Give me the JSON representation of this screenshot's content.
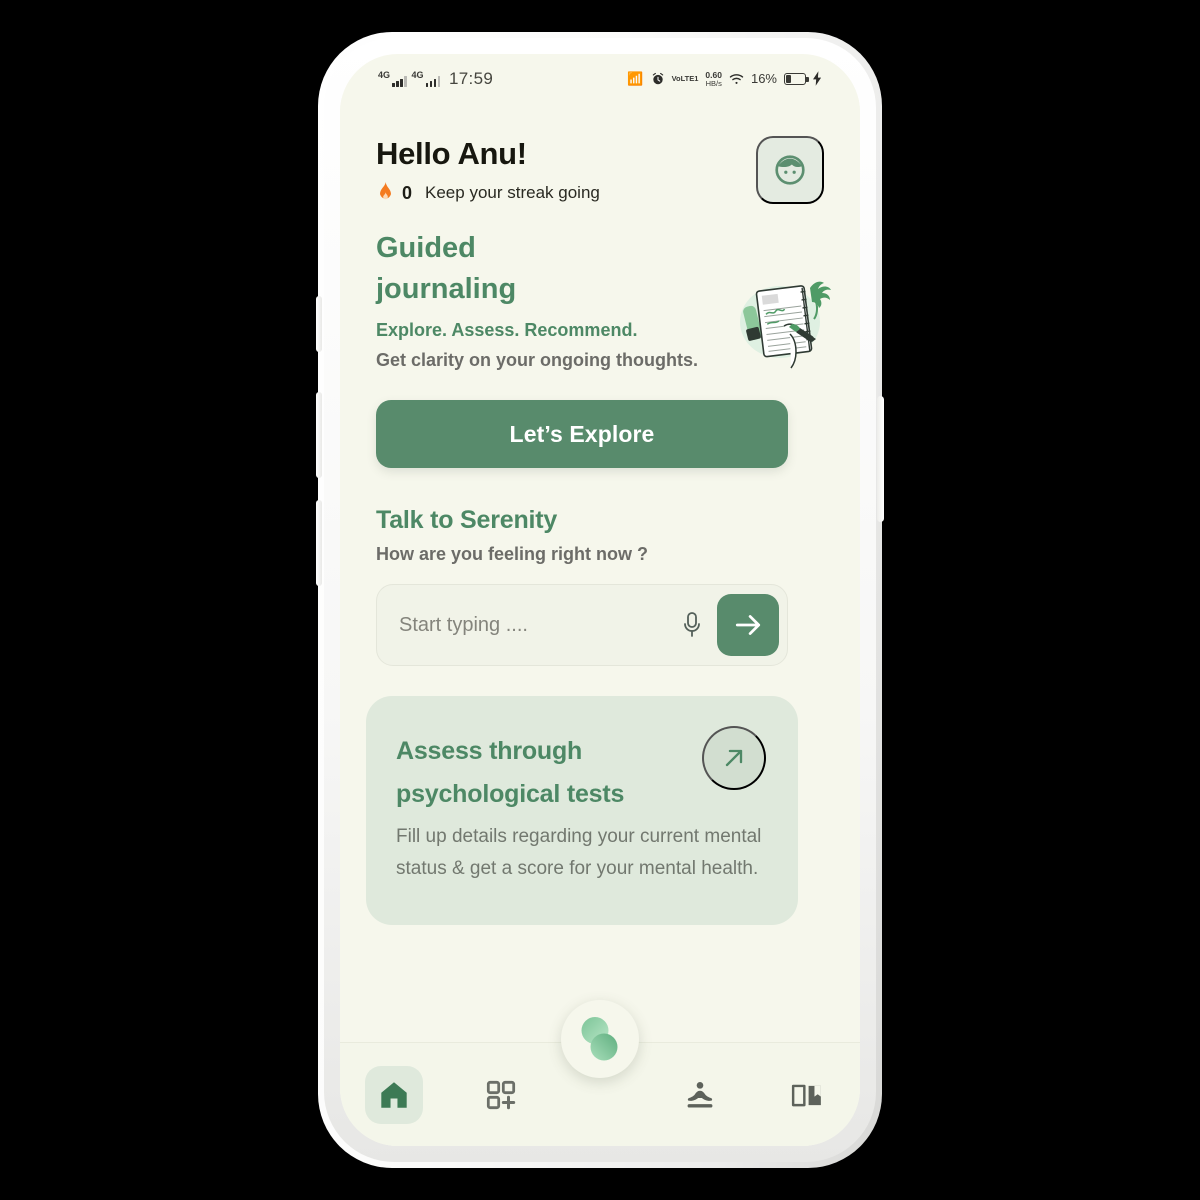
{
  "status_bar": {
    "network_label_1": "4G",
    "network_label_2": "4G",
    "time": "17:59",
    "bluetooth_icon": "bluetooth-icon",
    "alarm_icon": "alarm-icon",
    "volte": "VoLTE1",
    "net_speed_value": "0.60",
    "net_speed_unit": "HB/s",
    "wifi_icon": "wifi-icon",
    "battery_percent": "16%",
    "charging_icon": "charging-bolt-icon"
  },
  "header": {
    "greeting": "Hello Anu!",
    "streak_count": "0",
    "streak_text": "Keep your streak going",
    "flame_icon": "flame-icon",
    "avatar_icon": "avatar-face-icon"
  },
  "journal": {
    "title": "Guided journaling",
    "subtitle": "Explore. Assess. Recommend.",
    "description": "Get clarity on your ongoing thoughts.",
    "illustration": "journal-writing-illustration",
    "cta_label": "Let’s Explore"
  },
  "serenity": {
    "title": "Talk to Serenity",
    "subtitle": "How are you feeling right now ?",
    "input_value": "",
    "input_placeholder": "Start typing ....",
    "mic_icon": "microphone-icon",
    "send_icon": "arrow-right-icon"
  },
  "assess": {
    "title": "Assess through psychological tests",
    "description": "Fill up details regarding your current mental status & get a score for your mental health.",
    "arrow_icon": "arrow-up-right-icon"
  },
  "bottom_nav": {
    "items": [
      {
        "name": "home",
        "icon": "home-icon",
        "active": true
      },
      {
        "name": "explore",
        "icon": "grid-plus-icon",
        "active": false
      },
      {
        "name": "meditate",
        "icon": "meditation-icon",
        "active": false
      },
      {
        "name": "journal",
        "icon": "open-book-icon",
        "active": false
      }
    ],
    "fab_icon": "serenity-logo-icon"
  },
  "colors": {
    "background": "#f6f7ec",
    "primary_green": "#588b6c",
    "heading_green": "#4d8865",
    "card_green": "#dfe9dc",
    "muted_text": "#6c6c68",
    "flame_orange": "#f47b20"
  }
}
